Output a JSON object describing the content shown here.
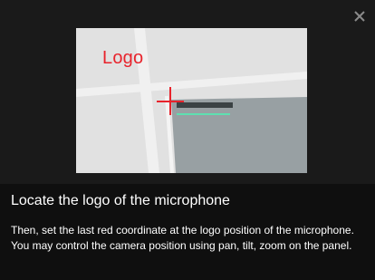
{
  "dialog": {
    "illustration": {
      "marker_label": "Logo"
    },
    "title": "Locate the logo of the microphone",
    "description": "Then, set the last red coordinate at the logo position of the microphone. You may control the camera position using pan, tilt, zoom on the panel.",
    "close_icon": "close-icon"
  },
  "colors": {
    "dialog_background": "#1a1a1a",
    "text_panel_background": "#0f0f0f",
    "marker": "#e8232c",
    "logo_highlight": "#5ee0b0",
    "text": "#ffffff"
  }
}
